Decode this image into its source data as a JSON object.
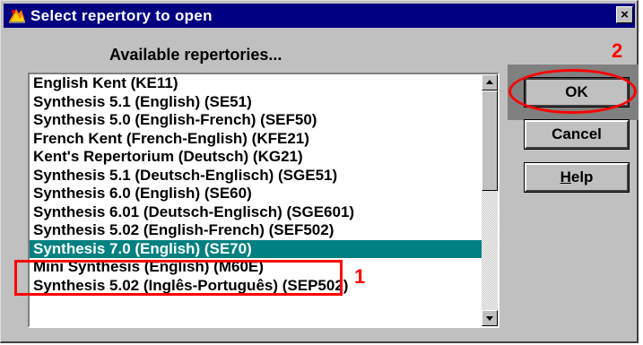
{
  "window": {
    "title": "Select repertory to open",
    "close_label": "×"
  },
  "heading": "Available repertories...",
  "list": {
    "items": [
      "English Kent (KE11)",
      "Synthesis 5.1 (English) (SE51)",
      "Synthesis 5.0 (English-French) (SEF50)",
      "French Kent (French-English) (KFE21)",
      "Kent's Repertorium (Deutsch) (KG21)",
      "Synthesis 5.1 (Deutsch-Englisch) (SGE51)",
      "Synthesis 6.0 (English) (SE60)",
      "Synthesis 6.01 (Deutsch-Englisch) (SGE601)",
      "Synthesis 5.02 (English-French) (SEF502)",
      "Synthesis 7.0 (English) (SE70)",
      "Mini Synthesis (English) (M60E)",
      "Synthesis 5.02 (Inglês-Português) (SEP502)"
    ],
    "selected_index": 9,
    "selection_color": "#008080"
  },
  "buttons": {
    "ok": "OK",
    "cancel": "Cancel",
    "help_underlined": "H",
    "help_rest": "elp"
  },
  "annotations": {
    "marker_1": "1",
    "marker_2": "2",
    "color": "#ff0000"
  },
  "colors": {
    "titlebar": "#000080",
    "face": "#c0c0c0"
  }
}
